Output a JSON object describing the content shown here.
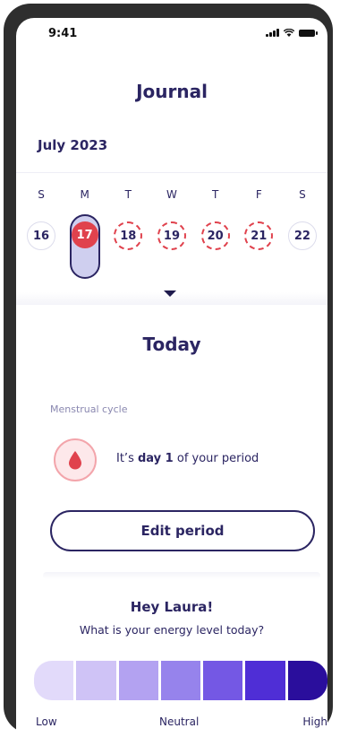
{
  "status_bar": {
    "time": "9:41"
  },
  "header": {
    "title": "Journal"
  },
  "calendar": {
    "month": "July 2023",
    "weekdays": [
      "S",
      "M",
      "T",
      "W",
      "T",
      "F",
      "S"
    ],
    "days": [
      "16",
      "17",
      "18",
      "19",
      "20",
      "21",
      "22"
    ],
    "selected_day": "17",
    "predicted_period_days": [
      "18",
      "19",
      "20",
      "21"
    ]
  },
  "today": {
    "heading": "Today",
    "cycle_label": "Menstrual cycle",
    "period_prefix": "It’s",
    "period_day": "day 1",
    "period_suffix": "of your period",
    "edit_button": "Edit period",
    "icon": "blood-drop-icon"
  },
  "energy": {
    "greeting": "Hey Laura!",
    "question": "What is your energy level today?",
    "levels": 7,
    "colors": [
      "#e2dafa",
      "#cfc3f6",
      "#b3a2f1",
      "#9683ec",
      "#7458e4",
      "#4f2ed6",
      "#2a0e9c"
    ],
    "label_low": "Low",
    "label_neutral": "Neutral",
    "label_high": "High"
  },
  "colors": {
    "accent": "#e0424d",
    "primary": "#2b2562"
  }
}
